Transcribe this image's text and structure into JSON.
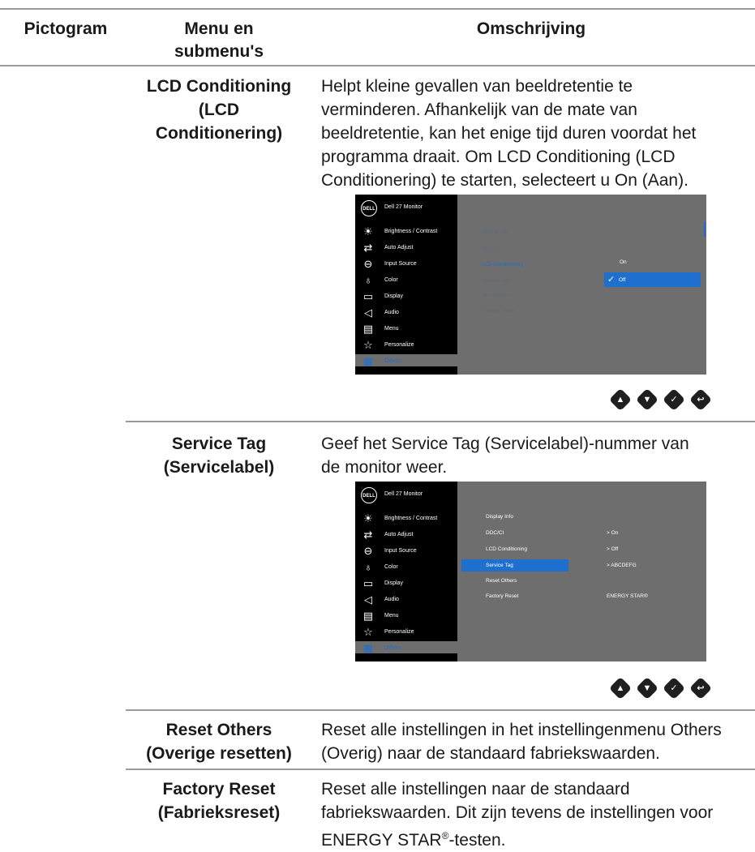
{
  "header": {
    "col1": "Pictogram",
    "col2_line1": "Menu en",
    "col2_line2": "submenu's",
    "col3": "Omschrijving"
  },
  "rows": [
    {
      "menu": [
        "LCD Conditioning",
        "(LCD",
        "Conditionering)"
      ],
      "desc_lines": [
        "Helpt kleine gevallen van beeldretentie te",
        "verminderen. Afhankelijk van de mate van",
        "beeldretentie, kan het enige tijd duren voordat het",
        "programma draait. Om ",
        "LCD Conditioning (LCD",
        "Conditionering)",
        " te starten, selecteert u On (Aan)."
      ]
    },
    {
      "menu": [
        "Service Tag",
        "(Servicelabel)"
      ],
      "desc_lines": [
        "Geef het ",
        "Service Tag (Servicelabel)",
        "-nummer van",
        "de monitor weer."
      ]
    },
    {
      "menu": [
        "Reset Others",
        "(Overige resetten)"
      ],
      "desc_lines": [
        "Reset alle instellingen in het instellingenmenu ",
        "Others",
        "(Overig)",
        " naar de standaard fabriekswaarden."
      ]
    },
    {
      "menu": [
        "Factory Reset",
        "(Fabrieksreset)"
      ],
      "desc_lines": [
        "Reset alle instellingen naar de standaard",
        "fabriekswaarden. Dit zijn tevens de instellingen voor",
        "ENERGY STAR",
        "®",
        "-testen."
      ]
    }
  ],
  "osd": {
    "logo": "DELL",
    "title": "Dell 27 Monitor",
    "menu_items": [
      {
        "label": "Brightness / Contrast",
        "icon": "brightness-icon",
        "glyph": "☀"
      },
      {
        "label": "Auto Adjust",
        "icon": "auto-adjust-icon",
        "glyph": "⇄"
      },
      {
        "label": "Input Source",
        "icon": "input-source-icon",
        "glyph": "⊖"
      },
      {
        "label": "Color",
        "icon": "color-icon",
        "glyph": "♁"
      },
      {
        "label": "Display",
        "icon": "display-icon",
        "glyph": "▭"
      },
      {
        "label": "Audio",
        "icon": "audio-icon",
        "glyph": "◁"
      },
      {
        "label": "Menu",
        "icon": "menu-icon",
        "glyph": "▤"
      },
      {
        "label": "Personalize",
        "icon": "personalize-icon",
        "glyph": "☆"
      },
      {
        "label": "Others",
        "icon": "others-icon",
        "glyph": "▦"
      }
    ],
    "sub_items": [
      "Display Info",
      "DDC/CI",
      "LCD Conditioning",
      "Service Tag",
      "Reset Others",
      "Factory Reset"
    ],
    "osd1_options": {
      "on": "On",
      "off": "Off",
      "check": "✓"
    },
    "osd2_values": {
      "ddc": "> On",
      "lcd": "> Off",
      "tag": "> ABCDEFG",
      "energy": "ENERGY STAR®"
    }
  },
  "nav_buttons": [
    {
      "icon": "up-icon",
      "glyph": "▲"
    },
    {
      "icon": "down-icon",
      "glyph": "▼"
    },
    {
      "icon": "check-icon",
      "glyph": "✓"
    },
    {
      "icon": "back-icon",
      "glyph": "↩"
    }
  ],
  "colors": {
    "accent_blue": "#1f6fcf",
    "osd_grey": "#6e6e6e",
    "rule_grey": "#9a9a9a"
  }
}
